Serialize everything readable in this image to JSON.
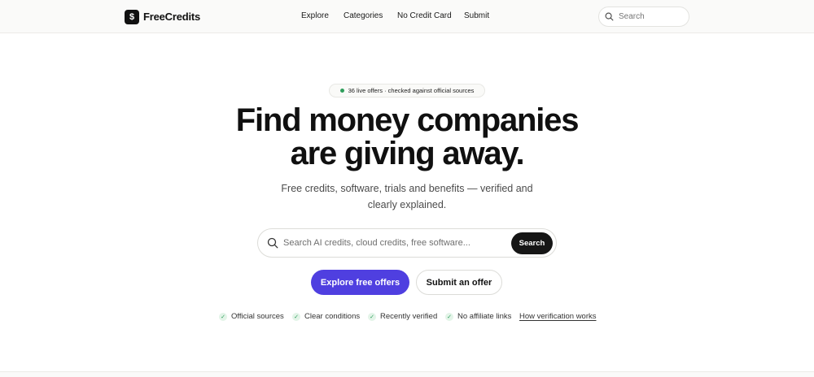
{
  "header": {
    "brand": "FreeCredits",
    "logo_glyph": "$",
    "nav": [
      "Explore",
      "Categories",
      "No Credit Card",
      "Submit"
    ],
    "search_placeholder": "Search"
  },
  "hero": {
    "badge": "36 live offers · checked against official sources",
    "headline_line1": "Find money companies",
    "headline_line2": "are giving away.",
    "subhead": "Free credits, software, trials and benefits — verified and clearly explained.",
    "search_placeholder": "Search AI credits, cloud credits, free software...",
    "search_button": "Search",
    "primary_cta": "Explore free offers",
    "secondary_cta": "Submit an offer"
  },
  "trust": {
    "items": [
      "Official sources",
      "Clear conditions",
      "Recently verified",
      "No affiliate links"
    ],
    "link": "How verification works"
  },
  "colors": {
    "accent": "#4f3fe0",
    "dark": "#161616",
    "success": "#2f9e5b"
  },
  "icons": {
    "search": "search-icon",
    "check": "check-icon",
    "logo": "dollar-logo-icon"
  }
}
